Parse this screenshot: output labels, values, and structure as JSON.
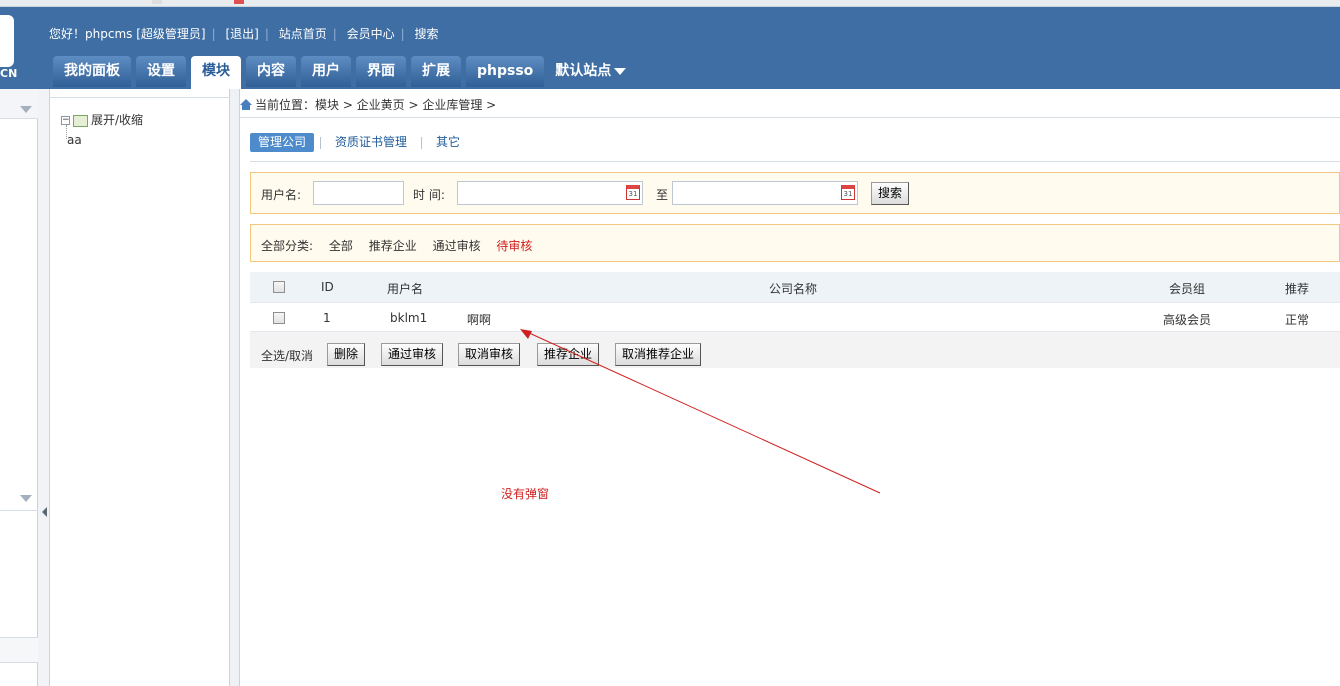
{
  "header": {
    "logo_text": "CN",
    "toplinks": [
      "您好！phpcms [超级管理员]",
      "[退出]",
      "站点首页",
      "会员中心",
      "搜索"
    ],
    "nav_tabs": [
      "我的面板",
      "设置",
      "模块",
      "内容",
      "用户",
      "界面",
      "扩展",
      "phpsso"
    ],
    "active_tab": "模块",
    "site_selector": "默认站点"
  },
  "tree": {
    "root_label": "展开/收缩",
    "child_label": "aa"
  },
  "breadcrumb": "当前位置：模块 > 企业黄页 > 企业库管理 >",
  "subtabs": [
    "管理公司",
    "资质证书管理",
    "其它"
  ],
  "search": {
    "username_label": "用户名:",
    "time_label": "时 间:",
    "to_label": "至",
    "calendar_day": "31",
    "button": "搜索"
  },
  "categories": {
    "label": "全部分类:",
    "items": [
      "全部",
      "推荐企业",
      "通过审核"
    ],
    "current": "待审核"
  },
  "table": {
    "headers": [
      "ID",
      "用户名",
      "公司名称",
      "会员组",
      "推荐"
    ],
    "rows": [
      {
        "id": "1",
        "username": "bklm1",
        "company": "啊啊",
        "group": "高级会员",
        "recommend": "正常"
      }
    ]
  },
  "actions": {
    "select_all_label": "全选/取消",
    "buttons": [
      "删除",
      "通过审核",
      "取消审核",
      "推荐企业",
      "取消推荐企业"
    ]
  },
  "annotation": {
    "text": "没有弹窗",
    "color": "#d01f1f"
  },
  "colors": {
    "header_bg": "#3e6ea3",
    "accent": "#4d8bcc",
    "highlight_red": "#d01f1f"
  }
}
